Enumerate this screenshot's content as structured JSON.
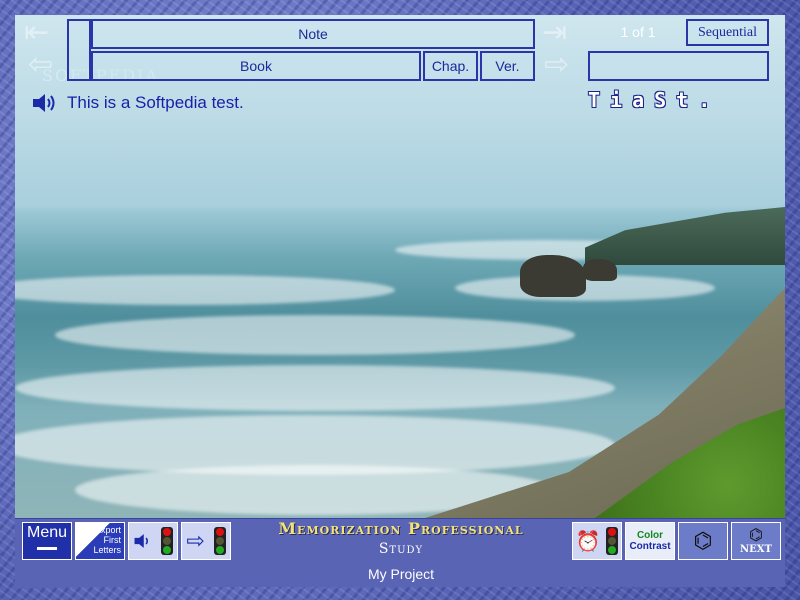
{
  "header": {
    "note_label": "Note",
    "book_label": "Book",
    "chapter_label": "Chap.",
    "verse_label": "Ver.",
    "page_indicator": "1 of 1",
    "mode_label": "Sequential"
  },
  "content": {
    "main_text": "This is a Softpedia test.",
    "hint_text": "TiaSt."
  },
  "watermark": "SOFTPEDIA",
  "toolbar": {
    "menu_label": "Menu",
    "export_line1": "Export",
    "export_line2": "First",
    "export_line3": "Letters",
    "color_label": "Color",
    "contrast_label": "Contrast",
    "next_label": "NEXT"
  },
  "footer": {
    "app_title": "Memorization Professional",
    "app_subtitle": "Study",
    "project_name": "My Project"
  },
  "icons": [
    "first-page-icon",
    "previous-page-icon",
    "last-page-icon",
    "next-page-icon",
    "speaker-icon",
    "traffic-light-icon",
    "arrow-right-icon",
    "alarm-clock-icon",
    "binoculars-icon"
  ],
  "colors": {
    "accent": "#2a36a8",
    "title": "#f1e27a",
    "text": "#1a1ea8"
  }
}
